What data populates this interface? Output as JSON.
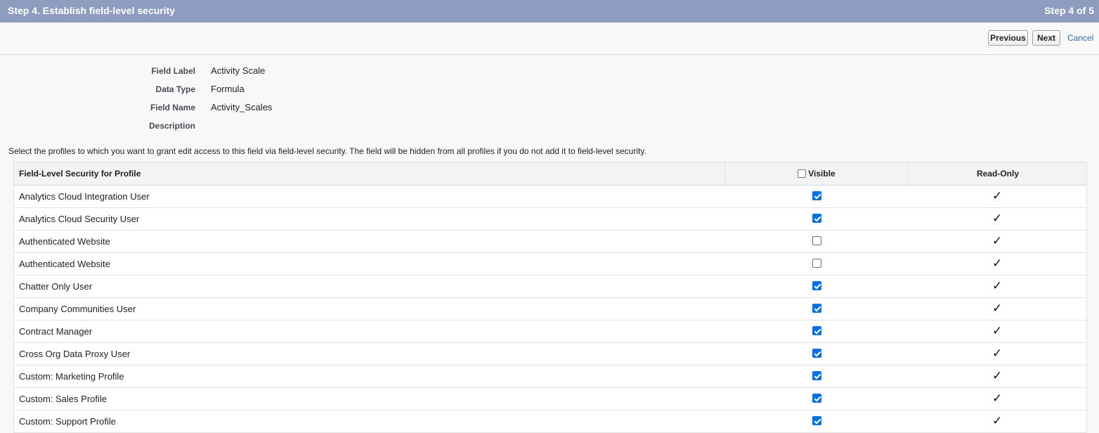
{
  "header": {
    "title": "Step 4. Establish field-level security",
    "step": "Step 4 of 5"
  },
  "buttons": {
    "previous": "Previous",
    "next": "Next",
    "cancel": "Cancel"
  },
  "details": [
    {
      "label": "Field Label",
      "value": "Activity Scale"
    },
    {
      "label": "Data Type",
      "value": "Formula"
    },
    {
      "label": "Field Name",
      "value": "Activity_Scales"
    },
    {
      "label": "Description",
      "value": ""
    }
  ],
  "instructions": "Select the profiles to which you want to grant edit access to this field via field-level security. The field will be hidden from all profiles if you do not add it to field-level security.",
  "table": {
    "columns": {
      "profile": "Field-Level Security for Profile",
      "visible": "Visible",
      "readonly": "Read-Only"
    },
    "rows": [
      {
        "profile": "Analytics Cloud Integration User",
        "visible": true,
        "readonly": "✓"
      },
      {
        "profile": "Analytics Cloud Security User",
        "visible": true,
        "readonly": "✓"
      },
      {
        "profile": "Authenticated Website",
        "visible": false,
        "readonly": "✓"
      },
      {
        "profile": "Authenticated Website",
        "visible": false,
        "readonly": "✓"
      },
      {
        "profile": "Chatter Only User",
        "visible": true,
        "readonly": "✓"
      },
      {
        "profile": "Company Communities User",
        "visible": true,
        "readonly": "✓"
      },
      {
        "profile": "Contract Manager",
        "visible": true,
        "readonly": "✓"
      },
      {
        "profile": "Cross Org Data Proxy User",
        "visible": true,
        "readonly": "✓"
      },
      {
        "profile": "Custom: Marketing Profile",
        "visible": true,
        "readonly": "✓"
      },
      {
        "profile": "Custom: Sales Profile",
        "visible": true,
        "readonly": "✓"
      },
      {
        "profile": "Custom: Support Profile",
        "visible": true,
        "readonly": "✓"
      }
    ]
  },
  "colors": {
    "header_bg": "#8e9dbf",
    "checkbox_checked": "#0b6fde",
    "link": "#2f6fb3"
  }
}
